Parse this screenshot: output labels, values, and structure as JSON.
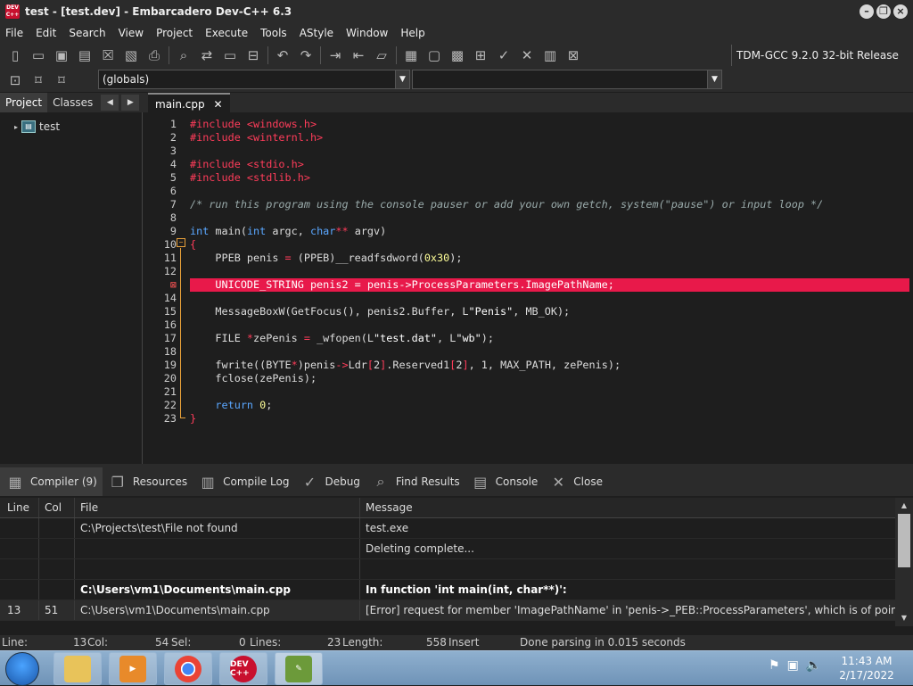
{
  "window": {
    "title": "test - [test.dev] - Embarcadero Dev-C++ 6.3",
    "app_icon_text": "DEV C++"
  },
  "menu": [
    "File",
    "Edit",
    "Search",
    "View",
    "Project",
    "Execute",
    "Tools",
    "AStyle",
    "Window",
    "Help"
  ],
  "toolbar": {
    "compiler": "TDM-GCC 9.2.0 32-bit Release"
  },
  "toolbar2": {
    "globals": "(globals)"
  },
  "left_panel": {
    "tabs": [
      "Project",
      "Classes"
    ],
    "tree": {
      "project": "test"
    }
  },
  "editor": {
    "tab": "main.cpp",
    "line_numbers": [
      "1",
      "2",
      "3",
      "4",
      "5",
      "6",
      "7",
      "8",
      "9",
      "10",
      "11",
      "12",
      "13",
      "14",
      "15",
      "16",
      "17",
      "18",
      "19",
      "20",
      "21",
      "22",
      "23"
    ],
    "error_line": 13
  },
  "bottom_tabs": [
    "Compiler (9)",
    "Resources",
    "Compile Log",
    "Debug",
    "Find Results",
    "Console",
    "Close"
  ],
  "messages": {
    "headers": {
      "line": "Line",
      "col": "Col",
      "file": "File",
      "message": "Message"
    },
    "rows": [
      {
        "line": "",
        "col": "",
        "file": "C:\\Projects\\test\\File not found",
        "message": "test.exe",
        "bold": false
      },
      {
        "line": "",
        "col": "",
        "file": "",
        "message": "Deleting complete...",
        "bold": false
      },
      {
        "line": "",
        "col": "",
        "file": "",
        "message": "",
        "bold": false
      },
      {
        "line": "",
        "col": "",
        "file": "C:\\Users\\vm1\\Documents\\main.cpp",
        "message": "In function 'int main(int, char**)':",
        "bold": true
      },
      {
        "line": "13",
        "col": "51",
        "file": "C:\\Users\\vm1\\Documents\\main.cpp",
        "message": "[Error] request for member 'ImagePathName' in 'penis->_PEB::ProcessParameters', which is of pointer t...",
        "bold": false
      }
    ]
  },
  "status": {
    "line_label": "Line:",
    "line_val": "13",
    "col_label": "Col:",
    "col_val": "54",
    "sel_label": "Sel:",
    "sel_val": "0",
    "lines_label": "Lines:",
    "lines_val": "23",
    "length_label": "Length:",
    "length_val": "558",
    "mode": "Insert",
    "msg": "Done parsing in 0.015 seconds"
  },
  "taskbar": {
    "time": "11:43 AM",
    "date": "2/17/2022",
    "devcpp_label": "DEV C++"
  }
}
